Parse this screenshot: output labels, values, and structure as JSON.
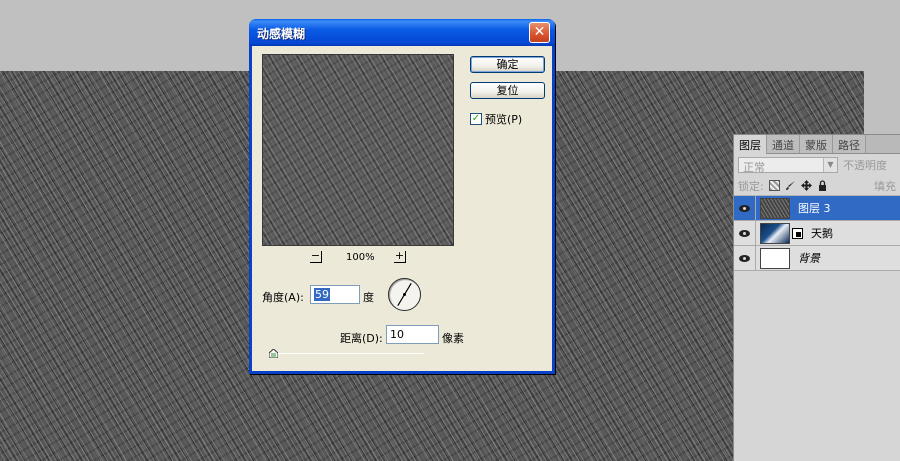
{
  "dialog": {
    "title": "动感模糊",
    "ok_label": "确定",
    "reset_label": "复位",
    "preview_label": "预览(P)",
    "preview_checked": true,
    "zoom_out": "−",
    "zoom_in": "+",
    "zoom_level": "100%",
    "angle_label": "角度(A):",
    "angle_value": "59",
    "angle_unit": "度",
    "distance_label": "距离(D):",
    "distance_value": "10",
    "distance_unit": "像素",
    "distance_slider_fraction": 0.01
  },
  "layers_panel": {
    "tabs": [
      "图层",
      "通道",
      "蒙版",
      "路径"
    ],
    "active_tab": 0,
    "blend_mode": "正常",
    "opacity_label": "不透明度",
    "lock_label": "锁定:",
    "fill_label": "填充",
    "layers": [
      {
        "name": "图层 3",
        "selected": true,
        "visible": true,
        "thumb": "rain"
      },
      {
        "name": "天鹅",
        "selected": false,
        "visible": true,
        "thumb": "swan",
        "has_mask_icon": true
      },
      {
        "name": "背景",
        "selected": false,
        "visible": true,
        "thumb": "white",
        "italic": true
      }
    ]
  },
  "colors": {
    "title_bar": "#0a5ae5",
    "dialog_bg": "#ece9d8",
    "selection": "#316ac5"
  }
}
